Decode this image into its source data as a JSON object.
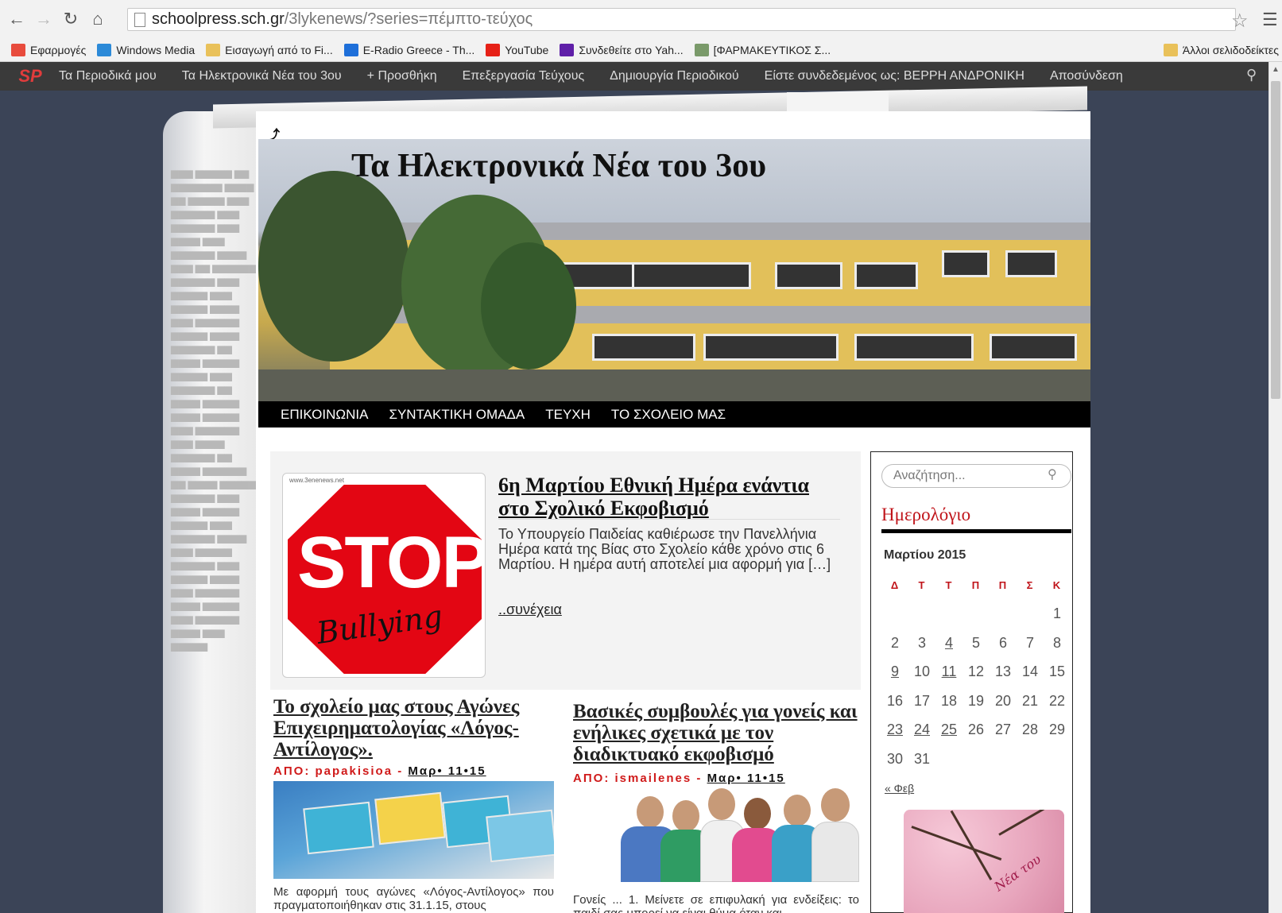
{
  "browser": {
    "url_host": "schoolpress.sch.gr",
    "url_path": "/3lykenews/?series=πέμπτο-τεύχος",
    "bookmarks": [
      {
        "label": "Εφαρμογές",
        "icon": "apps-grid-icon",
        "color": "#e84c3d"
      },
      {
        "label": "Windows Media",
        "icon": "windows-media-icon",
        "color": "#2c8ad8"
      },
      {
        "label": "Εισαγωγή από το Fi...",
        "icon": "folder-icon",
        "color": "#e9c15a"
      },
      {
        "label": "E-Radio Greece - Th...",
        "icon": "eradio-icon",
        "color": "#1e6fd9"
      },
      {
        "label": "YouTube",
        "icon": "youtube-icon",
        "color": "#e62117"
      },
      {
        "label": "Συνδεθείτε στο Yah...",
        "icon": "yahoo-icon",
        "color": "#5f1fa8"
      },
      {
        "label": "[ΦΑΡΜΑΚΕΥΤΙΚΟΣ Σ...",
        "icon": "pharmacy-icon",
        "color": "#7a9a6a"
      }
    ],
    "other_bookmarks": "Άλλοι σελιδοδείκτες"
  },
  "adminbar": {
    "logo": "SP",
    "items": [
      "Τα Περιοδικά μου",
      "Τα Ηλεκτρονικά Νέα του 3ου",
      "+ Προσθήκη",
      "Επεξεργασία Τεύχους",
      "Δημιουργία Περιοδικού",
      "Είστε συνδεδεμένος ως: ΒΕΡΡΗ ΑΝΔΡΟΝΙΚΗ",
      "Αποσύνδεση"
    ]
  },
  "site": {
    "title": "Τα Ηλεκτρονικά Νέα του 3ου",
    "nav": [
      "ΕΠΙΚΟΙΝΩΝΙΑ",
      "ΣΥΝΤΑΚΤΙΚΗ ΟΜΑΔΑ",
      "ΤΕΥΧΗ",
      "ΤΟ ΣΧΟΛΕΙΟ ΜΑΣ"
    ]
  },
  "featured": {
    "title": "6η Μαρτίου Εθνική Ημέρα ενάντια στο Σχολικό Εκφοβισμό",
    "excerpt": "Το Υπουργείο Παιδείας καθιέρωσε την Πανελλήνια Ημέρα κατά της Βίας στο Σχολείο κάθε χρόνο στις 6  Μαρτίου. Η ημέρα αυτή αποτελεί μια αφορμή για […]",
    "more": "..συνέχεια",
    "image_text_1": "STOP",
    "image_text_2": "Bullying",
    "image_watermark": "www.3enenews.net"
  },
  "posts": [
    {
      "title": "Το σχολείο μας στους Αγώνες Επιχειρηματολογίας «Λόγος-Αντίλογος».",
      "meta_prefix": "ΑΠΟ: ",
      "author": "papakisioa",
      "sep": " - ",
      "date": "Μαρ• 11•15",
      "text": "Με αφορμή τους αγώνες «Λόγος-Αντίλογος» που πραγματοποιήθηκαν στις 31.1.15, στους"
    },
    {
      "title": "Βασικές συμβουλές για γονείς και ενήλικες σχετικά με τον διαδικτυακό εκφοβισμό",
      "meta_prefix": "ΑΠΟ: ",
      "author": "ismailenes",
      "sep": " - ",
      "date": "Μαρ• 11•15",
      "text": "Γονείς ... 1. Μείνετε σε επιφυλακή για ενδείξεις: το παιδί σας μπορεί να είναι θύμα όταν και"
    }
  ],
  "sidebar": {
    "search_placeholder": "Αναζήτηση...",
    "calendar_title": "Ημερολόγιο",
    "calendar_caption": "Μαρτίου 2015",
    "weekdays": [
      "Δ",
      "Τ",
      "Τ",
      "Π",
      "Π",
      "Σ",
      "Κ"
    ],
    "weeks": [
      [
        "",
        "",
        "",
        "",
        "",
        "",
        "1"
      ],
      [
        "2",
        "3",
        "4",
        "5",
        "6",
        "7",
        "8"
      ],
      [
        "9",
        "10",
        "11",
        "12",
        "13",
        "14",
        "15"
      ],
      [
        "16",
        "17",
        "18",
        "19",
        "20",
        "21",
        "22"
      ],
      [
        "23",
        "24",
        "25",
        "26",
        "27",
        "28",
        "29"
      ],
      [
        "30",
        "31",
        "",
        "",
        "",
        "",
        ""
      ]
    ],
    "linked_days": [
      "4",
      "9",
      "11",
      "23",
      "24",
      "25"
    ],
    "prev_month": "« Φεβ",
    "widget_image_text": "Νέα του"
  }
}
